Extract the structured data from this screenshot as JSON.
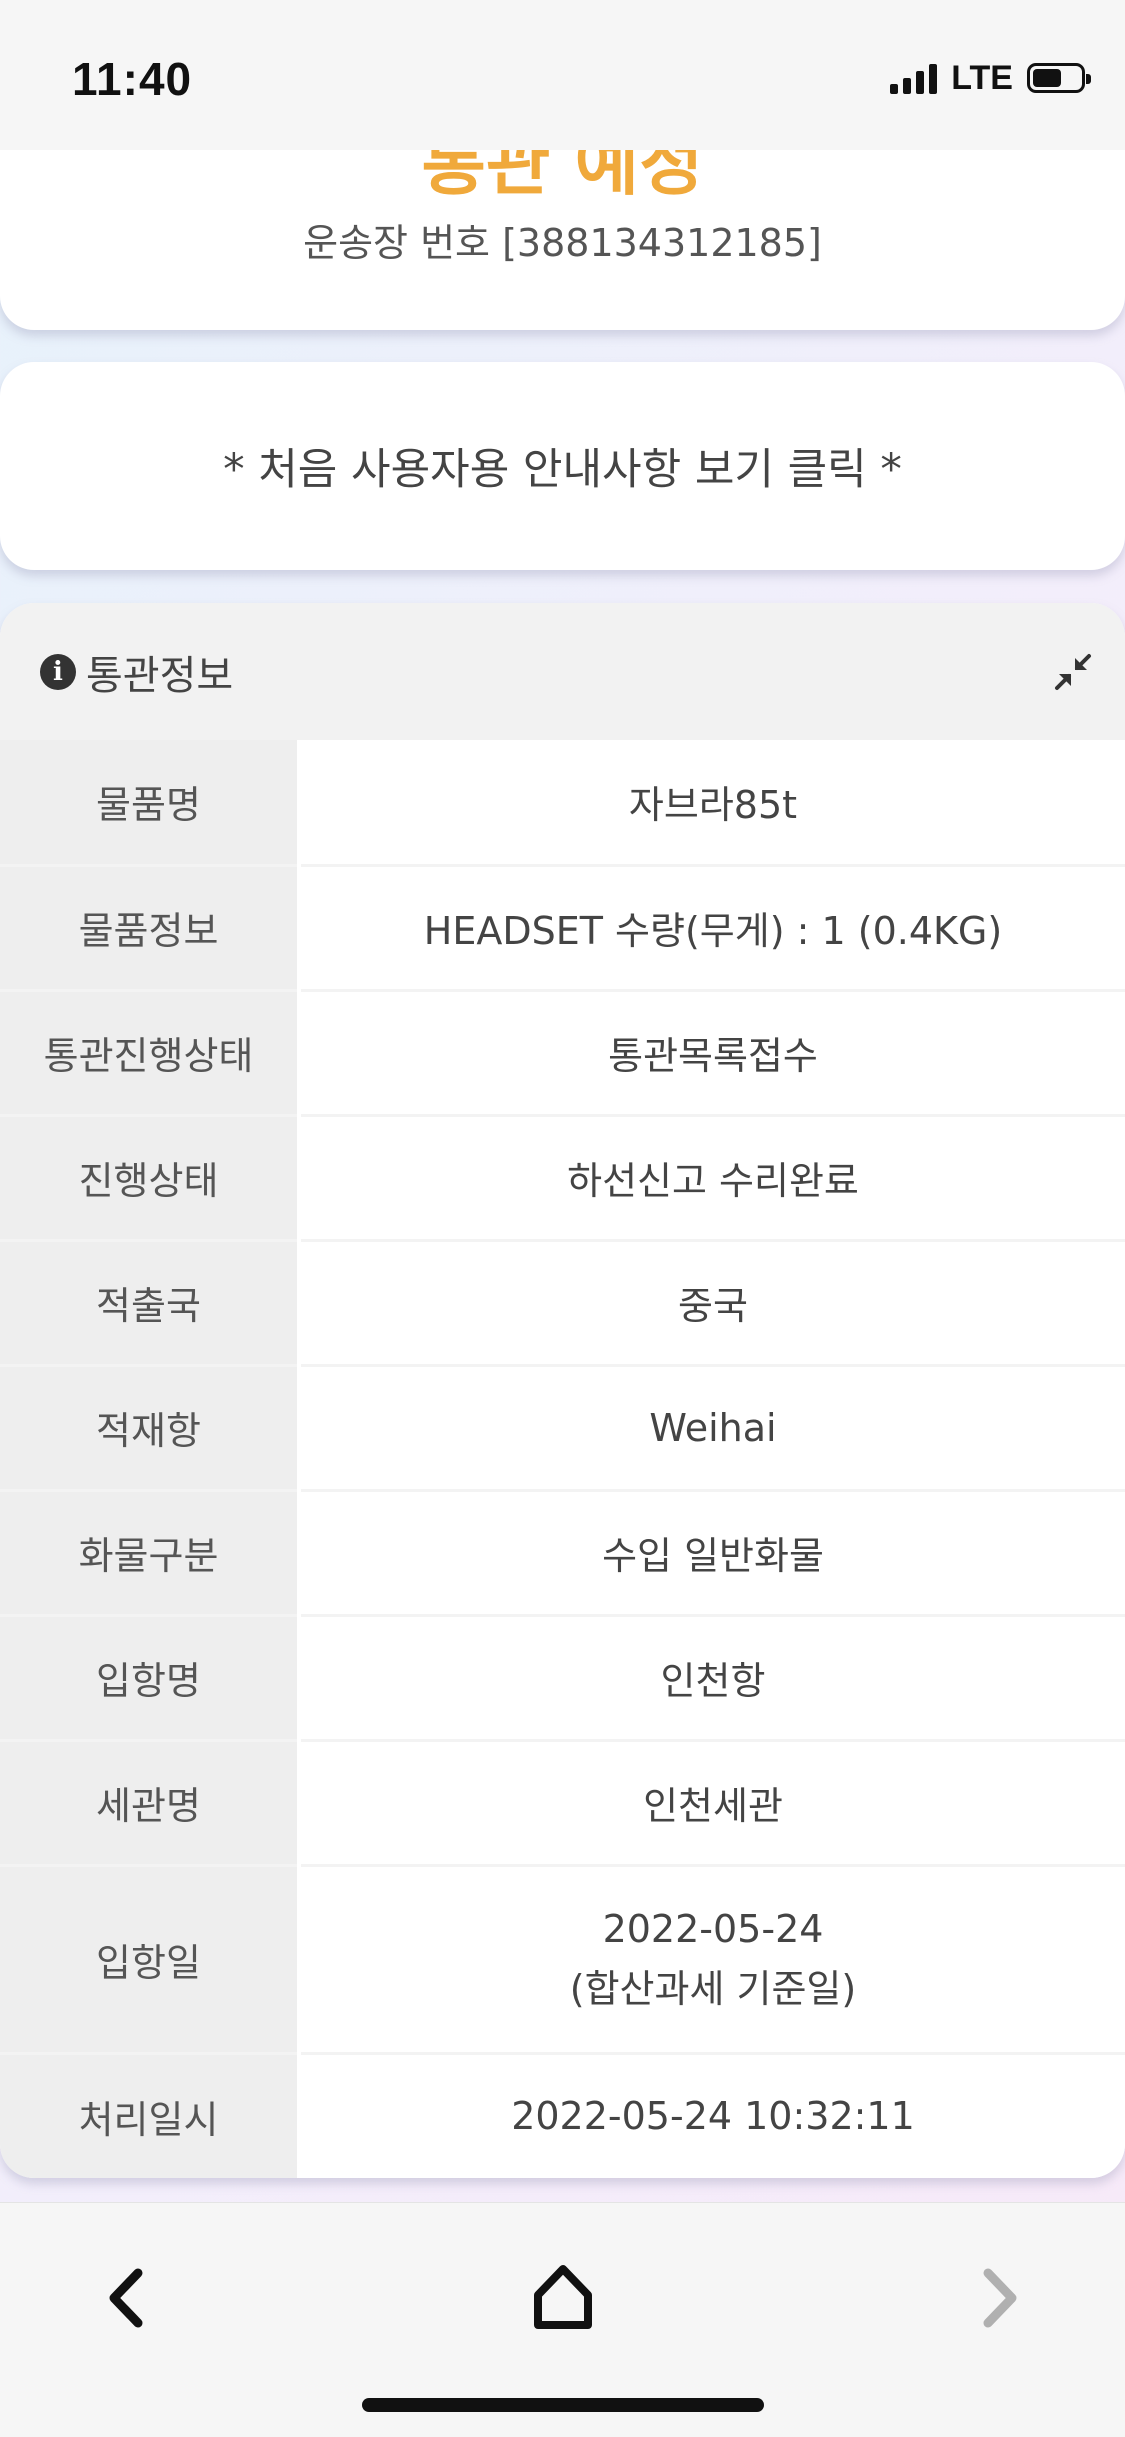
{
  "status_bar": {
    "time": "11:40",
    "network": "LTE",
    "battery_level": 0.6
  },
  "header_card": {
    "title_partial": "통관 예정",
    "tracking_text": "운송장 번호 [388134312185]"
  },
  "guide_card": {
    "text": "* 처음 사용자용 안내사항 보기 클릭 *"
  },
  "customs_panel": {
    "title": "통관정보",
    "info_icon_glyph": "i",
    "rows": [
      {
        "label": "물품명",
        "value": "자브라85t"
      },
      {
        "label": "물품정보",
        "value": "HEADSET 수량(무게) : 1 (0.4KG)"
      },
      {
        "label": "통관진행상태",
        "value": "통관목록접수"
      },
      {
        "label": "진행상태",
        "value": "하선신고 수리완료"
      },
      {
        "label": "적출국",
        "value": "중국"
      },
      {
        "label": "적재항",
        "value": "Weihai"
      },
      {
        "label": "화물구분",
        "value": "수입 일반화물"
      },
      {
        "label": "입항명",
        "value": "인천항"
      },
      {
        "label": "세관명",
        "value": "인천세관"
      },
      {
        "label": "입항일",
        "value": "2022-05-24",
        "value_sub": "(합산과세 기준일)"
      },
      {
        "label": "처리일시",
        "value": "2022-05-24 10:32:11"
      }
    ]
  },
  "bottom_nav": {
    "back_icon": "chevron-left-icon",
    "home_icon": "home-icon",
    "forward_icon": "chevron-right-icon"
  },
  "colors": {
    "accent_orange": "#f0a93b",
    "label_bg": "#eeeeee",
    "header_bg": "#f2f2f2"
  }
}
